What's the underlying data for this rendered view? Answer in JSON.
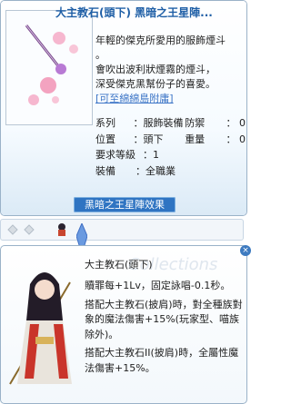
{
  "item": {
    "title": "大主教石(頭下) 黑暗之王星陣...",
    "description": [
      "年輕的傑克所愛用的服飾煙斗",
      "。",
      "會吹出波利狀煙霧的煙斗，",
      "深受傑克黑幫份子的喜愛。"
    ],
    "link_text": "[可至綿綿島附庸]",
    "stats": [
      {
        "k1": "系列",
        "v1": "：服飾裝備",
        "k2": "防禦",
        "v2": "：  0"
      },
      {
        "k1": "位置",
        "v1": "：頭下",
        "k2": "重量",
        "v2": "：  0"
      },
      {
        "k1": "要求等級",
        "v1": "：1",
        "k2": "",
        "v2": ""
      },
      {
        "k1": "裝備",
        "v1": "：全職業",
        "k2": "",
        "v2": ""
      }
    ],
    "set_button": "黑暗之王星陣效果"
  },
  "card": {
    "title": "大主教石(頭下)",
    "watermark": "Collections",
    "close_label": "×",
    "text": [
      "贖罪每+1Lv，固定詠唱-0.1秒。",
      "搭配大主教石(披肩)時，對全種族對象的魔法傷害+15%(玩家型、喵族除外)。",
      "搭配大主教石II(披肩)時，全屬性魔法傷害+15%。"
    ]
  }
}
